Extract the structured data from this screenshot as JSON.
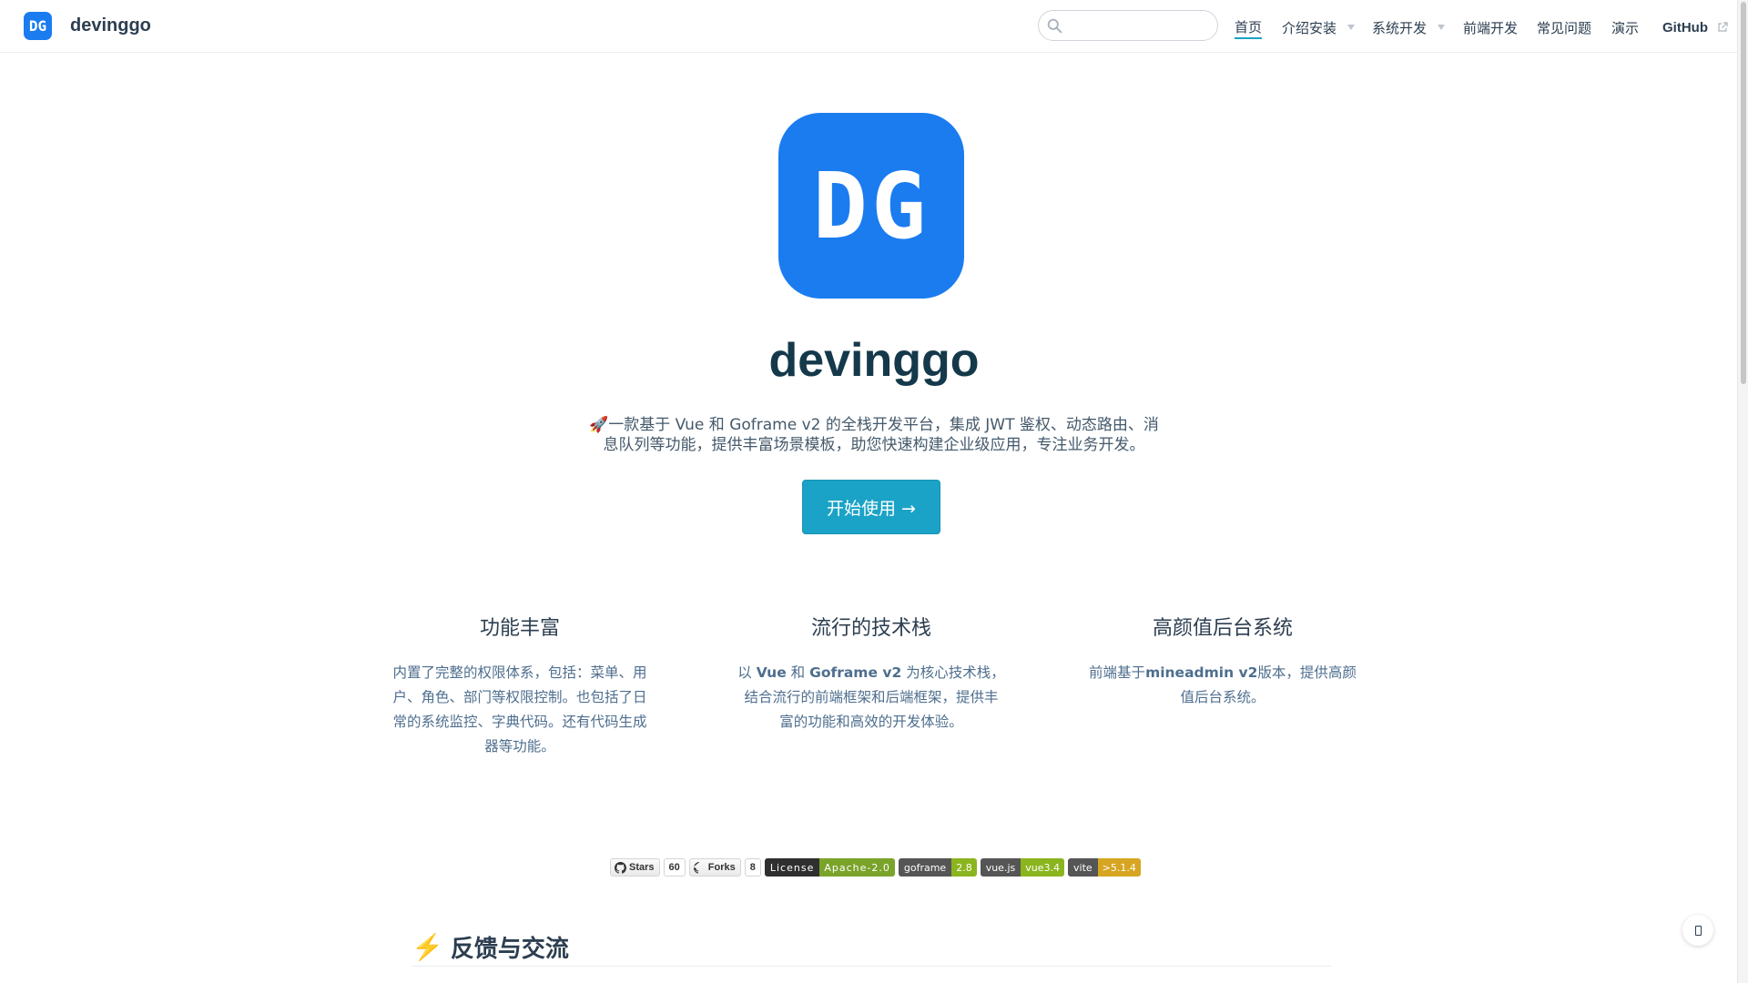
{
  "brand": {
    "logo_text": "DG",
    "name": "devinggo"
  },
  "search": {
    "placeholder": "",
    "value": ""
  },
  "nav": {
    "items": [
      {
        "label": "首页",
        "active": true,
        "dropdown": false
      },
      {
        "label": "介绍安装",
        "active": false,
        "dropdown": true
      },
      {
        "label": "系统开发",
        "active": false,
        "dropdown": true
      },
      {
        "label": "前端开发",
        "active": false,
        "dropdown": false
      },
      {
        "label": "常见问题",
        "active": false,
        "dropdown": false
      },
      {
        "label": "演示",
        "active": false,
        "dropdown": false
      },
      {
        "label": "GitHub",
        "active": false,
        "dropdown": false,
        "external": true
      }
    ]
  },
  "hero": {
    "logo_text": "DG",
    "title": "devinggo",
    "description": "🚀一款基于 Vue 和 Goframe v2 的全栈开发平台，集成 JWT 鉴权、动态路由、消息队列等功能，提供丰富场景模板，助您快速构建企业级应用，专注业务开发。",
    "cta_label": "开始使用 →"
  },
  "features": [
    {
      "title": "功能丰富",
      "desc": "内置了完整的权限体系，包括：菜单、用户、角色、部门等权限控制。也包括了日常的系统监控、字典代码。还有代码生成器等功能。"
    },
    {
      "title": "流行的技术栈",
      "desc_pre": "以 ",
      "bold1": "Vue",
      "mid1": " 和 ",
      "bold2": "Goframe v2",
      "desc_post": " 为核心技术栈，结合流行的前端框架和后端框架，提供丰富的功能和高效的开发体验。"
    },
    {
      "title": "高颜值后台系统",
      "desc_pre": "前端基于",
      "bold1": "mineadmin v2",
      "desc_post": "版本，提供高颜值后台系统。"
    }
  ],
  "badges": {
    "stars_label": "Stars",
    "stars_count": "60",
    "forks_label": "Forks",
    "forks_count": "8",
    "shields": [
      {
        "left": "License",
        "right": "Apache-2.0",
        "color": "#7aa32a",
        "kind": "license"
      },
      {
        "left": "goframe",
        "right": "2.8",
        "color": "#8bb51f"
      },
      {
        "left": "vue.js",
        "right": "vue3.4",
        "color": "#8bb51f"
      },
      {
        "left": "vite",
        "right": ">5.1.4",
        "color": "#d6a521"
      }
    ]
  },
  "section": {
    "icon": "⚡",
    "title": "反馈与交流"
  },
  "colors": {
    "accent": "#1aa3c6",
    "logo": "#1b7cf0",
    "text": "#2c3e50"
  }
}
